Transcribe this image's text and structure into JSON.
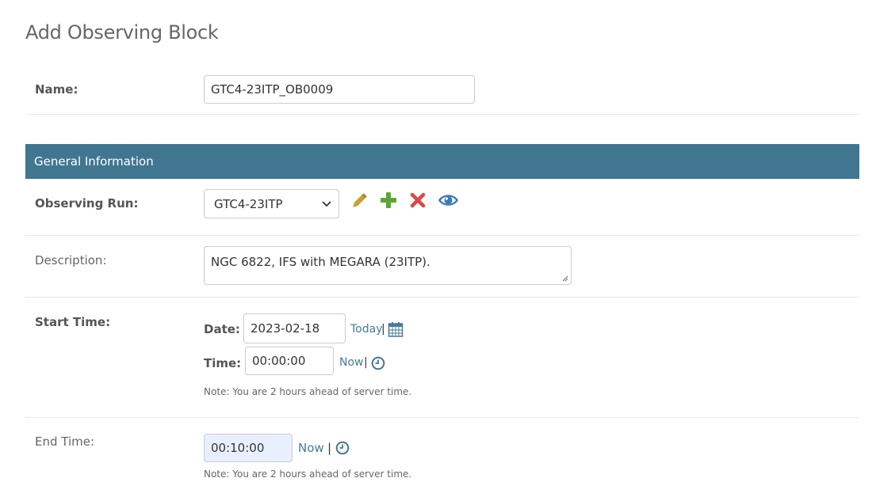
{
  "page": {
    "title": "Add Observing Block"
  },
  "name_field": {
    "label": "Name:",
    "value": "GTC4-23ITP_OB0009"
  },
  "general_section": {
    "header": "General Information"
  },
  "observing_run": {
    "label": "Observing Run:",
    "selected": "GTC4-23ITP",
    "actions": [
      "pencil-icon",
      "plus-icon",
      "delete-icon",
      "view-icon"
    ],
    "colors": {
      "edit": "#c8a232",
      "add": "#5ea631",
      "delete": "#dd4646",
      "view": "#3a7ab8"
    }
  },
  "description": {
    "label": "Description:",
    "value": "NGC 6822, IFS with MEGARA (23ITP)."
  },
  "start_time": {
    "label": "Start Time:",
    "date_label": "Date:",
    "date_value": "2023-02-18",
    "today_link": "Today",
    "separator": "|",
    "time_label": "Time:",
    "time_value": "00:00:00",
    "now_link": "Now",
    "note": "Note: You are 2 hours ahead of server time."
  },
  "end_time": {
    "label": "End Time:",
    "time_value": "00:10:00",
    "now_link": "Now",
    "separator": "|",
    "note": "Note: You are 2 hours ahead of server time."
  },
  "theme": {
    "header_bg": "#417690",
    "link": "#447e9b"
  }
}
